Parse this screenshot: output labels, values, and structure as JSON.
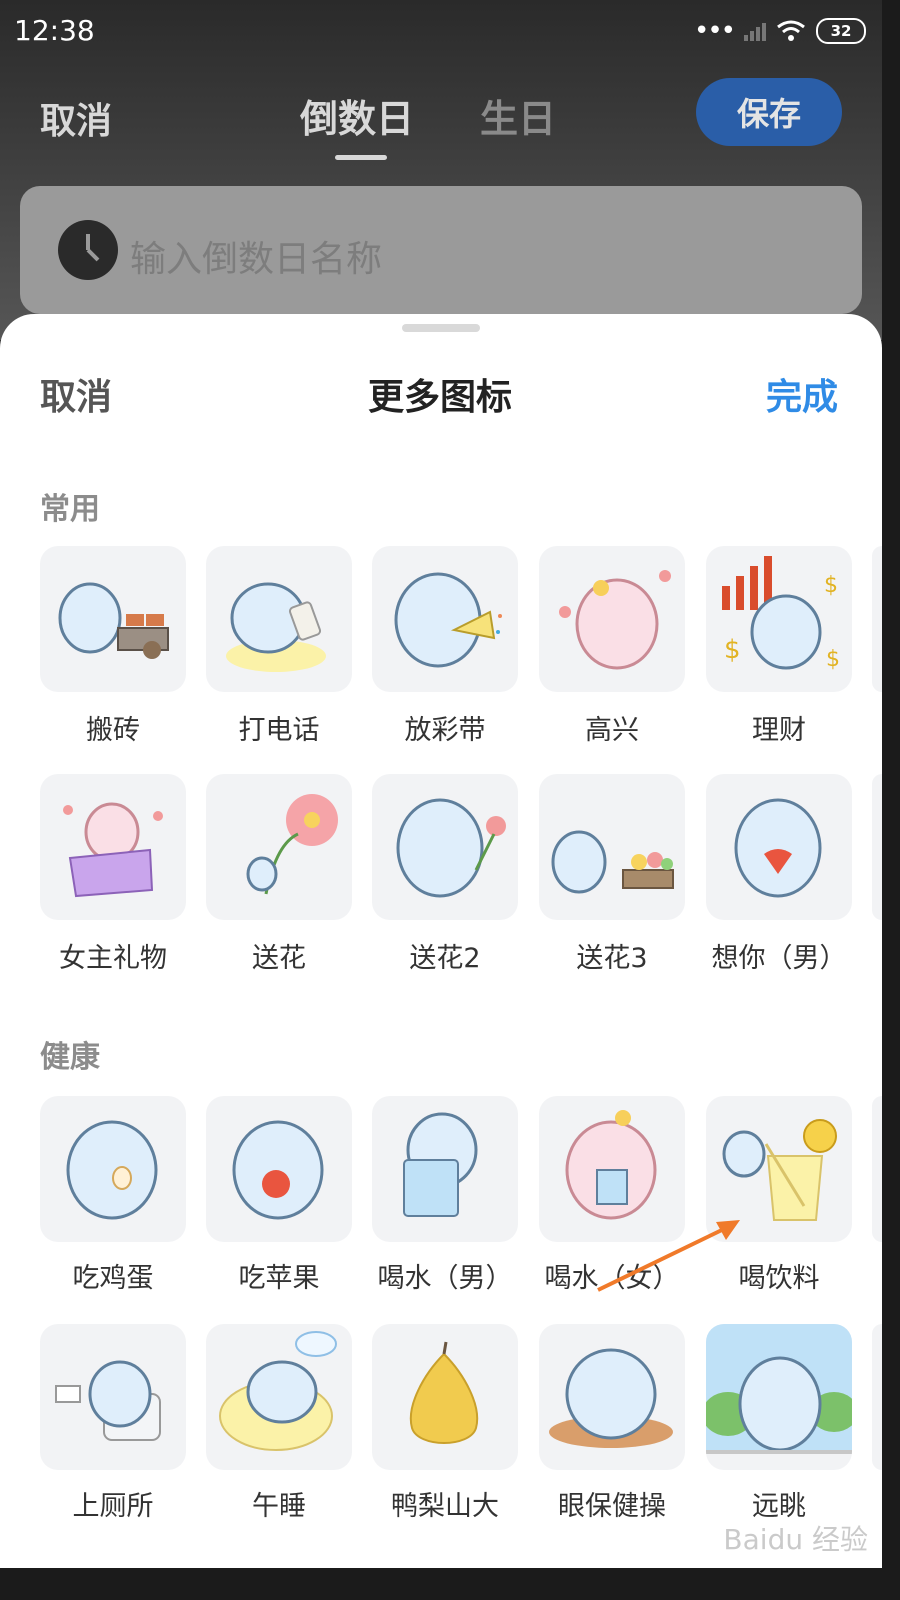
{
  "status": {
    "time": "12:38",
    "battery": "32"
  },
  "header": {
    "cancel": "取消",
    "tabs": [
      {
        "label": "倒数日"
      },
      {
        "label": "生日"
      }
    ],
    "save": "保存",
    "name_placeholder": "输入倒数日名称"
  },
  "sheet": {
    "cancel": "取消",
    "title": "更多图标",
    "done": "完成",
    "sections": [
      {
        "title": "常用",
        "items": [
          "搬砖",
          "打电话",
          "放彩带",
          "高兴",
          "理财",
          "女主礼物",
          "送花",
          "送花2",
          "送花3",
          "想你（男）"
        ]
      },
      {
        "title": "健康",
        "items": [
          "吃鸡蛋",
          "吃苹果",
          "喝水（男）",
          "喝水（女）",
          "喝饮料",
          "上厕所",
          "午睡",
          "鸭梨山大",
          "眼保健操",
          "远眺"
        ]
      }
    ]
  },
  "watermark": "Baidu 经验"
}
